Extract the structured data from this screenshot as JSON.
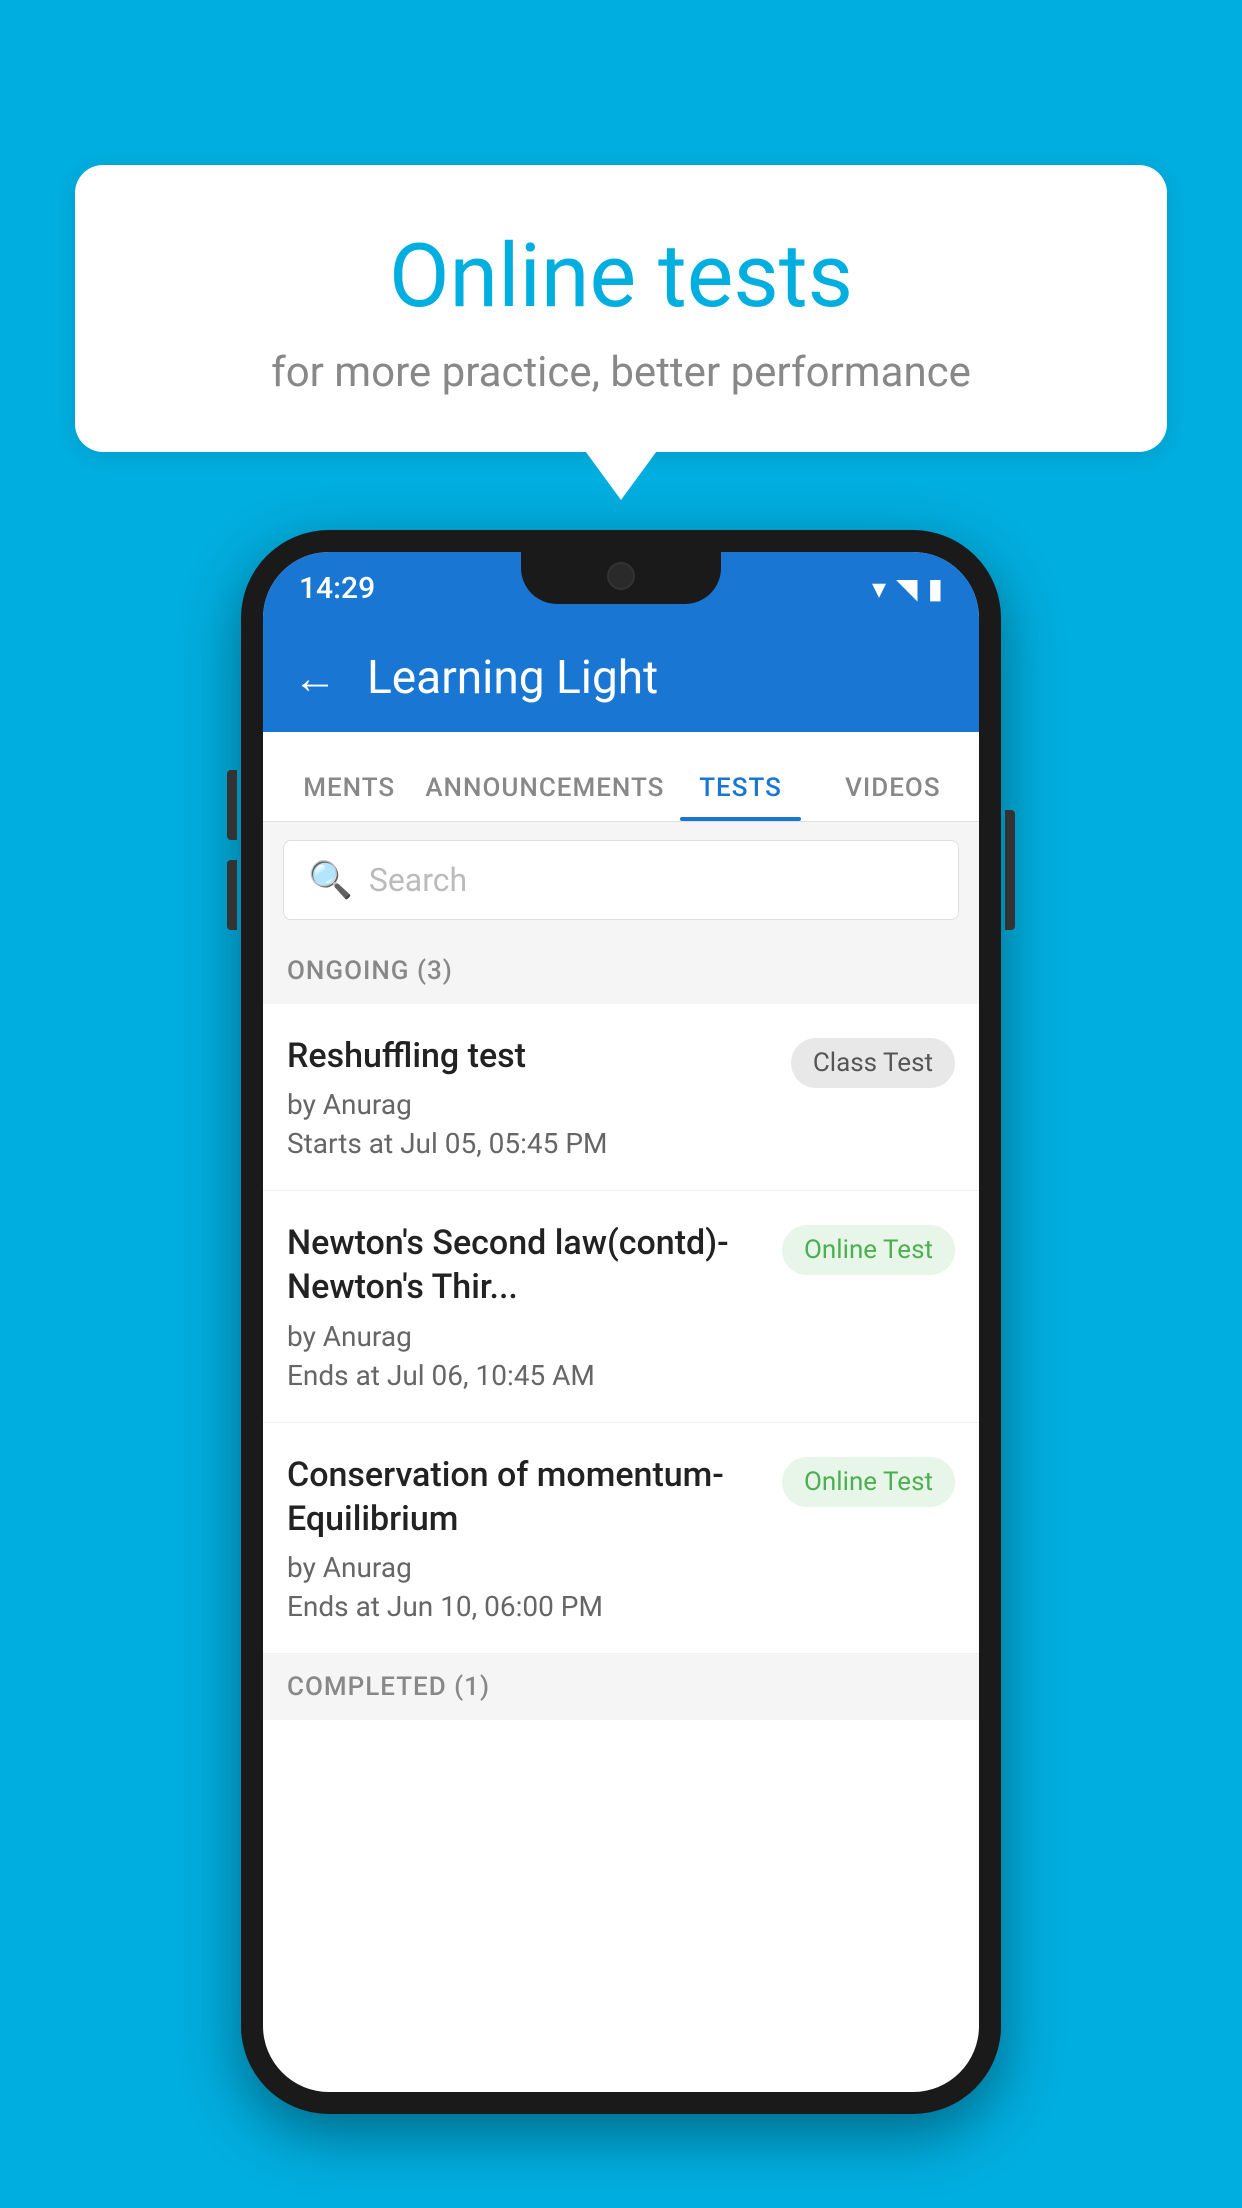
{
  "background_color": "#00AEDF",
  "speech_bubble": {
    "title": "Online tests",
    "subtitle": "for more practice, better performance"
  },
  "phone": {
    "status_bar": {
      "time": "14:29",
      "icons": [
        "wifi",
        "signal",
        "battery"
      ]
    },
    "app_bar": {
      "title": "Learning Light",
      "back_label": "←"
    },
    "tabs": [
      {
        "label": "MENTS",
        "active": false
      },
      {
        "label": "ANNOUNCEMENTS",
        "active": false
      },
      {
        "label": "TESTS",
        "active": true
      },
      {
        "label": "VIDEOS",
        "active": false
      }
    ],
    "search": {
      "placeholder": "Search"
    },
    "ongoing_section": {
      "label": "ONGOING (3)"
    },
    "tests": [
      {
        "name": "Reshuffling test",
        "by": "by Anurag",
        "time": "Starts at  Jul 05, 05:45 PM",
        "badge": "Class Test",
        "badge_type": "class"
      },
      {
        "name": "Newton's Second law(contd)-Newton's Thir...",
        "by": "by Anurag",
        "time": "Ends at  Jul 06, 10:45 AM",
        "badge": "Online Test",
        "badge_type": "online"
      },
      {
        "name": "Conservation of momentum-Equilibrium",
        "by": "by Anurag",
        "time": "Ends at  Jun 10, 06:00 PM",
        "badge": "Online Test",
        "badge_type": "online"
      }
    ],
    "completed_section": {
      "label": "COMPLETED (1)"
    }
  }
}
